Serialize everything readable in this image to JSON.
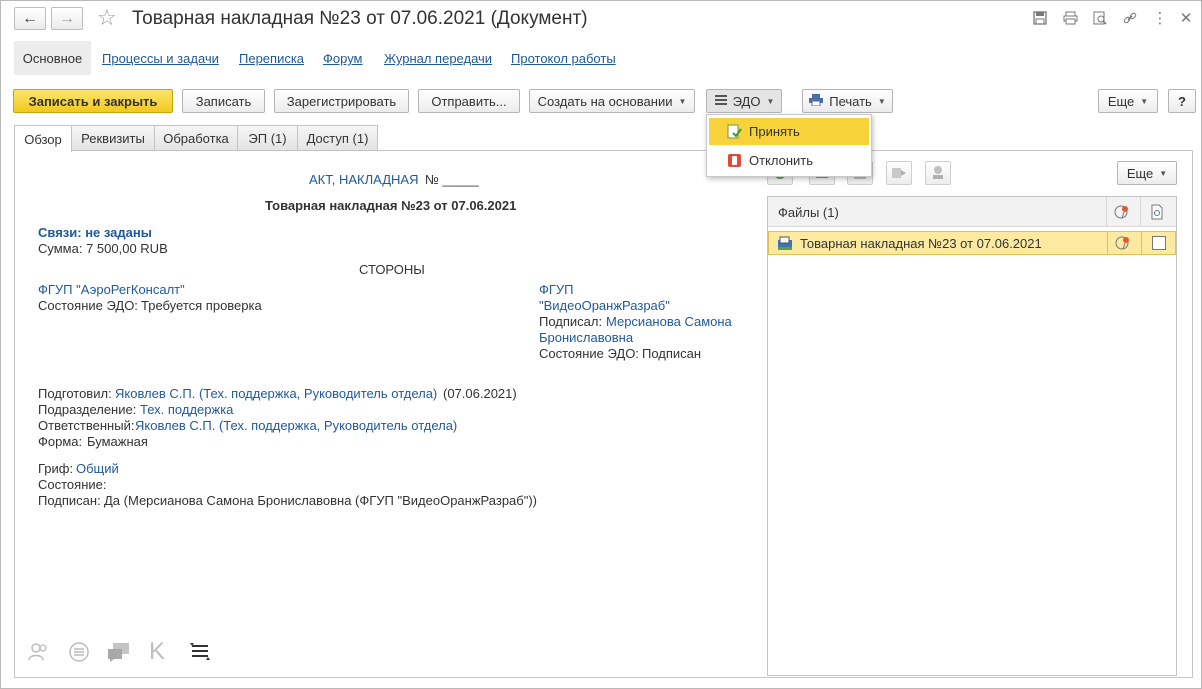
{
  "window": {
    "title": "Товарная накладная №23 от 07.06.2021 (Документ)",
    "more_icon": "⋮",
    "close_icon": "✕"
  },
  "sections": {
    "main": "Основное",
    "links": [
      "Процессы и задачи",
      "Переписка",
      "Форум",
      "Журнал передачи",
      "Протокол работы"
    ]
  },
  "toolbar": {
    "save_close": "Записать и закрыть",
    "save": "Записать",
    "register": "Зарегистрировать",
    "send": "Отправить...",
    "create_based": "Создать на основании",
    "edo": "ЭДО",
    "print": "Печать",
    "more": "Еще",
    "help": "?"
  },
  "edo_menu": {
    "accept": "Принять",
    "reject": "Отклонить"
  },
  "tabs": [
    "Обзор",
    "Реквизиты",
    "Обработка",
    "ЭП (1)",
    "Доступ (1)"
  ],
  "overview": {
    "doc_type_link": "АКТ, НАКЛАДНАЯ",
    "doc_number_label": "№ _____",
    "doc_title": "Товарная накладная №23 от 07.06.2021",
    "links_label": "Связи: не заданы",
    "amount": "Сумма: 7 500,00 RUB",
    "parties_heading": "СТОРОНЫ",
    "party_left": {
      "name": "ФГУП \"АэроРегКонсалт\"",
      "edo_label": "Состояние ЭДО:",
      "edo_value": "Требуется проверка"
    },
    "party_right": {
      "name_line1": "ФГУП",
      "name_line2": "\"ВидеоОранжРазраб\"",
      "signed_label": "Подписал:",
      "signer_line1": "Мерсианова Самона",
      "signer_line2": "Брониславовна",
      "edo_label": "Состояние ЭДО:",
      "edo_value": "Подписан"
    },
    "prepared_label": "Подготовил:",
    "prepared_value": "Яковлев С.П. (Тех. поддержка, Руководитель отдела)",
    "prepared_date": "(07.06.2021)",
    "division_label": "Подразделение:",
    "division_value": "Тех. поддержка",
    "responsible_label": "Ответственный:",
    "responsible_value": "Яковлев С.П. (Тех. поддержка, Руководитель отдела)",
    "form_label": "Форма:",
    "form_value": "Бумажная",
    "grif_label": "Гриф:",
    "grif_value": "Общий",
    "state_label": "Состояние:",
    "signed_label": "Подписан:",
    "signed_value": "Да (Мерсианова Самона Брониславовна (ФГУП \"ВидеоОранжРазраб\"))"
  },
  "files": {
    "more": "Еще",
    "header": "Файлы (1)",
    "rows": [
      {
        "name": "Товарная накладная №23 от 07.06.2021"
      }
    ]
  },
  "colors": {
    "accent_yellow": "#f2c91c",
    "link_blue": "#215a9a",
    "row_highlight": "#fbeaa0"
  }
}
